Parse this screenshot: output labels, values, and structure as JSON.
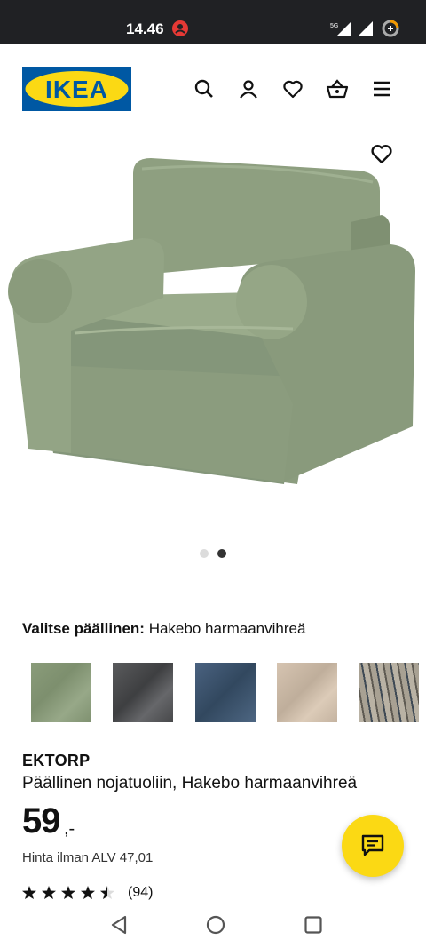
{
  "status_bar": {
    "time": "14.46",
    "network": "5G"
  },
  "header": {
    "logo_text": "IKEA",
    "brand_colors": {
      "blue": "#0058a3",
      "yellow": "#fbd914"
    },
    "icons": [
      "search-icon",
      "user-icon",
      "heart-icon",
      "basket-icon",
      "menu-icon"
    ]
  },
  "gallery": {
    "image_index": 2,
    "image_count": 2,
    "product_color": "#8c9f7e"
  },
  "cover": {
    "label": "Valitse päällinen:",
    "selected": "Hakebo harmaanvihreä",
    "swatches": [
      {
        "color": "#8a9c7a",
        "selected": true
      },
      {
        "color": "#4d4e50",
        "selected": false
      },
      {
        "color": "#3c5470",
        "selected": false
      },
      {
        "color": "#cdbba8",
        "selected": false
      },
      {
        "color": "#9a9488",
        "selected": false
      }
    ]
  },
  "product": {
    "name": "EKTORP",
    "description": "Päällinen nojatuoliin, Hakebo harmaanvihreä",
    "price": "59",
    "price_suffix": ",-",
    "vat_text": "Hinta ilman ALV 47,01",
    "rating": 4.5,
    "rating_count": "(94)"
  },
  "chat": {
    "color": "#fbd914"
  }
}
